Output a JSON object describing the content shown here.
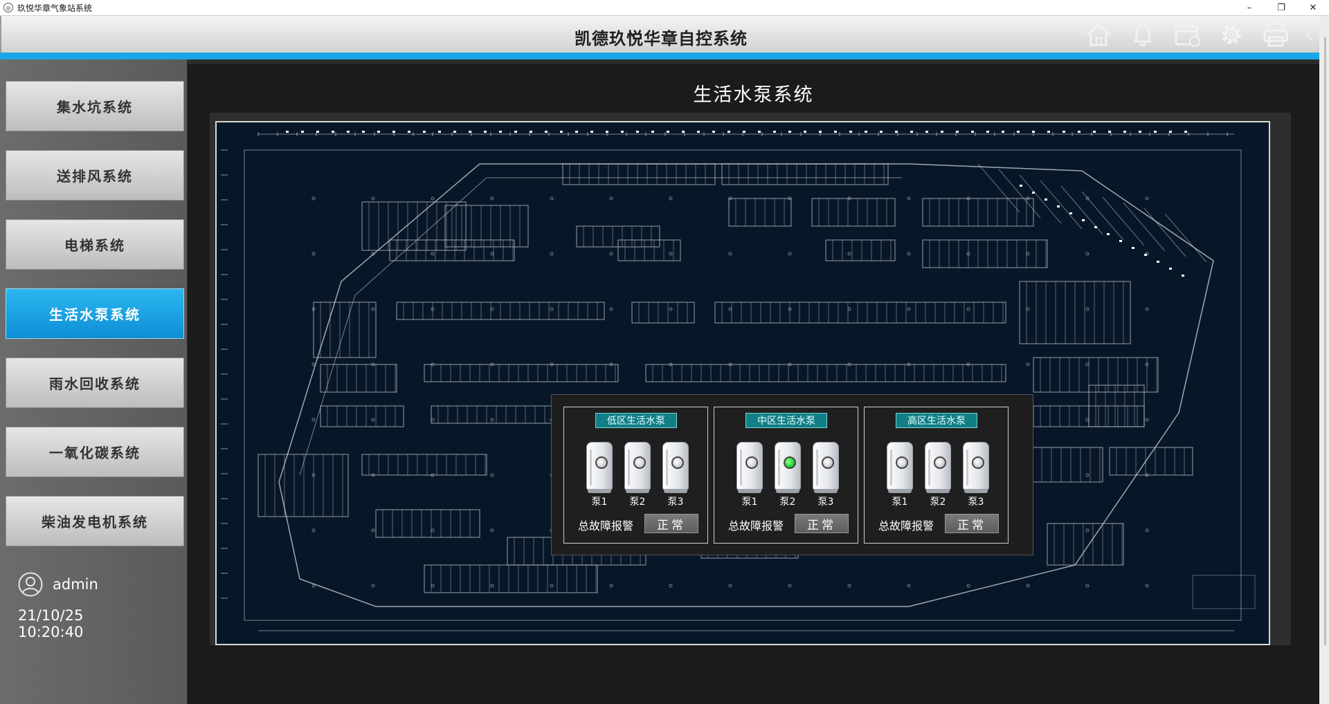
{
  "window": {
    "title": "玖悦华章气象站系统",
    "minimize": "–",
    "restore": "❐",
    "close": "✕"
  },
  "header": {
    "title": "凯德玖悦华章自控系统",
    "icons": [
      "home-icon",
      "bell-icon",
      "calendar-icon",
      "gear-icon",
      "printer-icon",
      "power-icon"
    ]
  },
  "sidebar": {
    "items": [
      {
        "label": "集水坑系统",
        "active": false
      },
      {
        "label": "送排风系统",
        "active": false
      },
      {
        "label": "电梯系统",
        "active": false
      },
      {
        "label": "生活水泵系统",
        "active": true
      },
      {
        "label": "雨水回收系统",
        "active": false
      },
      {
        "label": "一氧化碳系统",
        "active": false
      },
      {
        "label": "柴油发电机系统",
        "active": false
      }
    ],
    "user": "admin",
    "date": "21/10/25",
    "time": "10:20:40"
  },
  "colors": {
    "accent": "#19a6e8",
    "active_button": "#0d8fd6",
    "panel_title": "#127f86",
    "running_lamp": "#1fd32a"
  },
  "main": {
    "title": "生活水泵系统",
    "groups": [
      {
        "title": "低区生活水泵",
        "pumps": [
          {
            "label": "泵1",
            "running": false
          },
          {
            "label": "泵2",
            "running": false
          },
          {
            "label": "泵3",
            "running": false
          }
        ],
        "fault_label": "总故障报警",
        "fault_value": "正常"
      },
      {
        "title": "中区生活水泵",
        "pumps": [
          {
            "label": "泵1",
            "running": false
          },
          {
            "label": "泵2",
            "running": true
          },
          {
            "label": "泵3",
            "running": false
          }
        ],
        "fault_label": "总故障报警",
        "fault_value": "正常"
      },
      {
        "title": "高区生活水泵",
        "pumps": [
          {
            "label": "泵1",
            "running": false
          },
          {
            "label": "泵2",
            "running": false
          },
          {
            "label": "泵3",
            "running": false
          }
        ],
        "fault_label": "总故障报警",
        "fault_value": "正常"
      }
    ]
  }
}
